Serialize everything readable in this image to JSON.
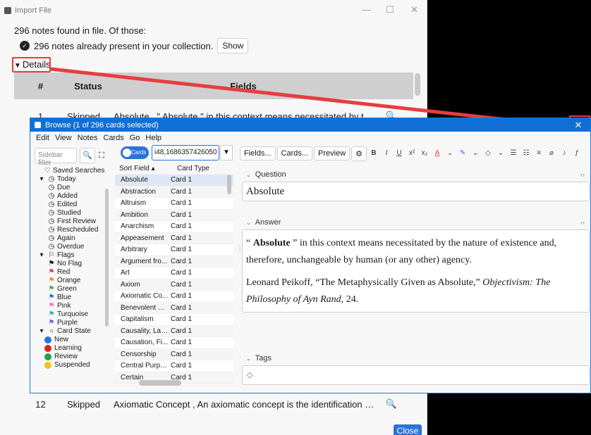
{
  "import_window": {
    "title": "Import File",
    "summary": "296 notes found in file. Of those:",
    "present_text": "296 notes already present in your collection.",
    "show_label": "Show",
    "details_label": "Details",
    "table": {
      "headers": [
        "#",
        "Status",
        "Fields"
      ],
      "rows": [
        {
          "num": "1",
          "status": "Skipped",
          "fields": "Absolute , \" Absolute \" in this context means necessitated by the natu..."
        },
        {
          "num": "12",
          "status": "Skipped",
          "fields": "Axiomatic Concept , An axiomatic concept is the identification of a pr..."
        }
      ]
    },
    "close_label": "Close"
  },
  "browse_window": {
    "title": "Browse (1 of 296 cards selected)",
    "menu": [
      "Edit",
      "View",
      "Notes",
      "Cards",
      "Go",
      "Help"
    ],
    "sidebar": {
      "filter_placeholder": "Sidebar filter",
      "items": [
        {
          "label": "Saved Searches",
          "icon": "heart-icon"
        },
        {
          "label": "Today",
          "icon": "clock-icon"
        },
        {
          "label": "Due",
          "icon": "clock-icon"
        },
        {
          "label": "Added",
          "icon": "clock-icon"
        },
        {
          "label": "Edited",
          "icon": "clock-icon"
        },
        {
          "label": "Studied",
          "icon": "clock-icon"
        },
        {
          "label": "First Review",
          "icon": "clock-icon"
        },
        {
          "label": "Rescheduled",
          "icon": "clock-icon"
        },
        {
          "label": "Again",
          "icon": "clock-icon"
        },
        {
          "label": "Overdue",
          "icon": "clock-icon"
        },
        {
          "label": "Flags",
          "icon": "flag-icon"
        },
        {
          "label": "No Flag",
          "icon": "no-flag-icon"
        },
        {
          "label": "Red",
          "icon": "flag-icon",
          "color": "#e53e3e"
        },
        {
          "label": "Orange",
          "icon": "flag-icon",
          "color": "#f28c28"
        },
        {
          "label": "Green",
          "icon": "flag-icon",
          "color": "#3cb043"
        },
        {
          "label": "Blue",
          "icon": "flag-icon",
          "color": "#2b73d9"
        },
        {
          "label": "Pink",
          "icon": "flag-icon",
          "color": "#e86fd0"
        },
        {
          "label": "Turquoise",
          "icon": "flag-icon",
          "color": "#22b8b0"
        },
        {
          "label": "Purple",
          "icon": "flag-icon",
          "color": "#8a4fd8"
        },
        {
          "label": "Card State",
          "icon": "circle-icon"
        },
        {
          "label": "New",
          "icon": "dot-icon",
          "color": "#2b73d9"
        },
        {
          "label": "Learning",
          "icon": "dot-icon",
          "color": "#e02020"
        },
        {
          "label": "Review",
          "icon": "dot-icon",
          "color": "#22a33a"
        },
        {
          "label": "Suspended",
          "icon": "dot-icon",
          "color": "#f0c419"
        }
      ]
    },
    "toggle_label": "Cards",
    "search_value": "i48,1686357426050",
    "card_list": {
      "headers": [
        "Sort Field",
        "Card Type"
      ],
      "rows": [
        [
          "Absolute",
          "Card 1"
        ],
        [
          "Abstraction",
          "Card 1"
        ],
        [
          "Altruism",
          "Card 1"
        ],
        [
          "Ambition",
          "Card 1"
        ],
        [
          "Anarchism",
          "Card 1"
        ],
        [
          "Appeasement",
          "Card 1"
        ],
        [
          "Arbitrary",
          "Card 1"
        ],
        [
          "Argument fro...",
          "Card 1"
        ],
        [
          "Art",
          "Card 1"
        ],
        [
          "Axiom",
          "Card 1"
        ],
        [
          "Axiomatic Co...",
          "Card 1"
        ],
        [
          "Benevolent Un...",
          "Card 1"
        ],
        [
          "Capitalism",
          "Card 1"
        ],
        [
          "Causality, Law of",
          "Card 1"
        ],
        [
          "Causation, Fi...",
          "Card 1"
        ],
        [
          "Censorship",
          "Card 1"
        ],
        [
          "Central Purpose",
          "Card 1"
        ],
        [
          "Certain",
          "Card 1"
        ]
      ]
    },
    "editor": {
      "buttons": [
        "Fields...",
        "Cards...",
        "Preview"
      ],
      "question_label": "Question",
      "question_value": "Absolute",
      "answer_label": "Answer",
      "answer_prefix": "“ ",
      "answer_bold": "Absolute",
      "answer_rest": " ” in this context means necessitated by the nature of existence and, therefore, unchangeable by human (or any other) agency.",
      "answer_cite_a": "Leonard Peikoff, “The Metaphysically Given as Absolute,” ",
      "answer_cite_italic": "Objectivism: The Philosophy of Ayn Rand,",
      "answer_cite_b": " 24.",
      "tags_label": "Tags"
    }
  }
}
